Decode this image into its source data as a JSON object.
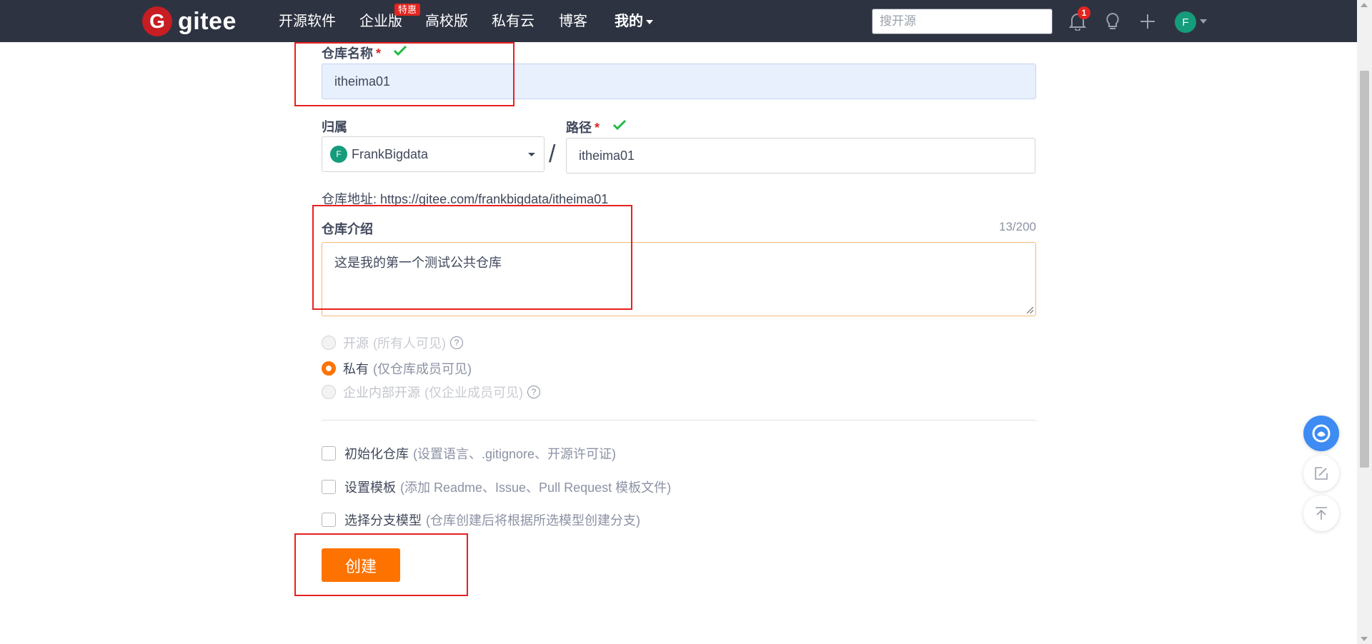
{
  "nav": {
    "logo_letter": "G",
    "logo_text": "gitee",
    "items": [
      {
        "label": "开源软件"
      },
      {
        "label": "企业版"
      },
      {
        "label": "高校版"
      },
      {
        "label": "私有云"
      },
      {
        "label": "博客"
      },
      {
        "label": "我的"
      }
    ],
    "promo_badge": "特惠",
    "search_placeholder": "搜开源",
    "notification_count": "1",
    "avatar_letter": "F"
  },
  "form": {
    "repo_name": {
      "label": "仓库名称",
      "required_mark": "*",
      "value": "itheima01"
    },
    "owner": {
      "label": "归属",
      "avatar_letter": "F",
      "value": "FrankBigdata"
    },
    "path_separator": "/",
    "path": {
      "label": "路径",
      "required_mark": "*",
      "value": "itheima01"
    },
    "address": {
      "label": "仓库地址:",
      "url": "https://gitee.com/frankbigdata/itheima01"
    },
    "description": {
      "label": "仓库介绍",
      "counter": "13/200",
      "value": "这是我的第一个测试公共仓库"
    },
    "visibility": [
      {
        "label": "开源",
        "hint": "(所有人可见)",
        "selected": false,
        "disabled": true,
        "help": "?"
      },
      {
        "label": "私有",
        "hint": "(仅仓库成员可见)",
        "selected": true,
        "disabled": false
      },
      {
        "label": "企业内部开源",
        "hint": "(仅企业成员可见)",
        "selected": false,
        "disabled": true,
        "help": "?"
      }
    ],
    "options": [
      {
        "label": "初始化仓库",
        "hint": "(设置语言、.gitignore、开源许可证)",
        "checked": false
      },
      {
        "label": "设置模板",
        "hint": "(添加 Readme、Issue、Pull Request 模板文件)",
        "checked": false
      },
      {
        "label": "选择分支模型",
        "hint": "(仓库创建后将根据所选模型创建分支)",
        "checked": false
      }
    ],
    "submit_label": "创建"
  },
  "colors": {
    "nav_bg": "#2e3342",
    "accent_orange": "#fe7300",
    "brand_red": "#c71d23",
    "highlight_red": "#e82020",
    "valid_green": "#21ba45"
  }
}
